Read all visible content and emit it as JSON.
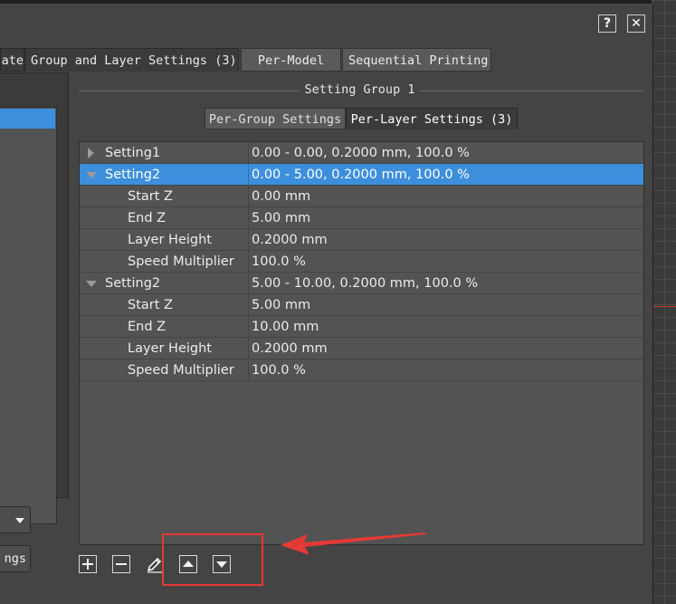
{
  "dialog": {
    "help_label": "?",
    "close_label": "✕",
    "tabs": [
      {
        "label": "ate"
      },
      {
        "label": "Group and Layer Settings (3)"
      },
      {
        "label": "Per-Model"
      },
      {
        "label": "Sequential Printing"
      }
    ],
    "left_panel": {
      "button_label": "ngs"
    },
    "setting_group": {
      "title": "Setting Group 1",
      "subtabs": [
        {
          "label": "Per-Group Settings"
        },
        {
          "label": "Per-Layer Settings (3)"
        }
      ],
      "rows": [
        {
          "name": "Setting1",
          "value": "0.00 - 0.00, 0.2000 mm, 100.0 %"
        },
        {
          "name": "Setting2",
          "value": "0.00 - 5.00, 0.2000 mm, 100.0 %"
        },
        {
          "name": "Start Z",
          "value": "0.00 mm"
        },
        {
          "name": "End Z",
          "value": "5.00 mm"
        },
        {
          "name": "Layer Height",
          "value": "0.2000 mm"
        },
        {
          "name": "Speed Multiplier",
          "value": "100.0 %"
        },
        {
          "name": "Setting2",
          "value": "5.00 - 10.00, 0.2000 mm, 100.0 %"
        },
        {
          "name": "Start Z",
          "value": "5.00 mm"
        },
        {
          "name": "End Z",
          "value": "10.00 mm"
        },
        {
          "name": "Layer Height",
          "value": "0.2000 mm"
        },
        {
          "name": "Speed Multiplier",
          "value": "100.0 %"
        }
      ]
    },
    "toolbar": {
      "icons": [
        "plus-icon",
        "minus-icon",
        "pencil-icon",
        "triangle-up-icon",
        "triangle-down-icon"
      ]
    }
  },
  "colors": {
    "selection": "#3d8fdc",
    "annotation": "#e53935",
    "dialog_bg": "#444444"
  }
}
